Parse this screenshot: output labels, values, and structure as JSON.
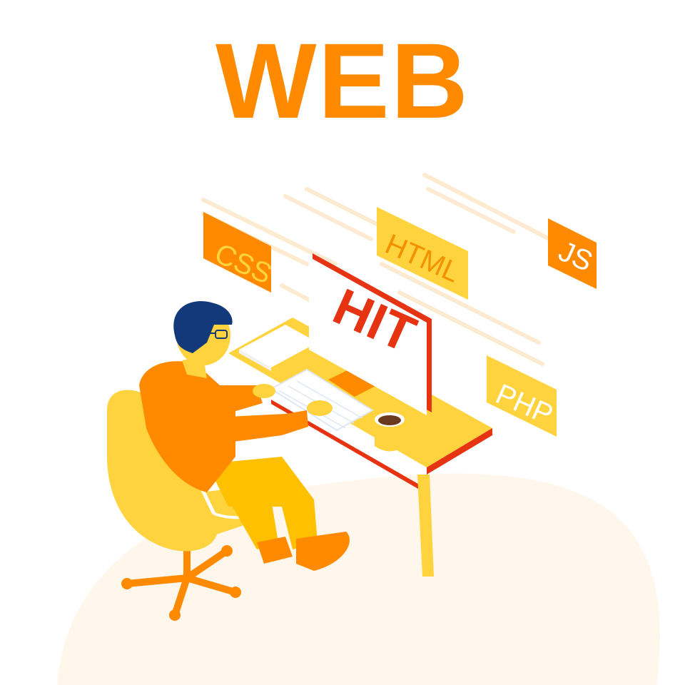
{
  "title": "WEB",
  "tags": {
    "css": "CSS",
    "html": "HTML",
    "js": "JS",
    "php": "PHP"
  },
  "monitor": {
    "label": "HIT"
  },
  "colors": {
    "brand_orange": "#ff8a00",
    "accent_yellow": "#ffd33d",
    "monitor_red": "#e63312",
    "hair_navy": "#123a7a",
    "background_blob": "#fff6ec"
  },
  "icons": [
    "css-tag",
    "html-tag",
    "js-tag",
    "php-tag",
    "monitor",
    "keyboard",
    "coffee-cup",
    "office-chair",
    "developer-figure"
  ]
}
